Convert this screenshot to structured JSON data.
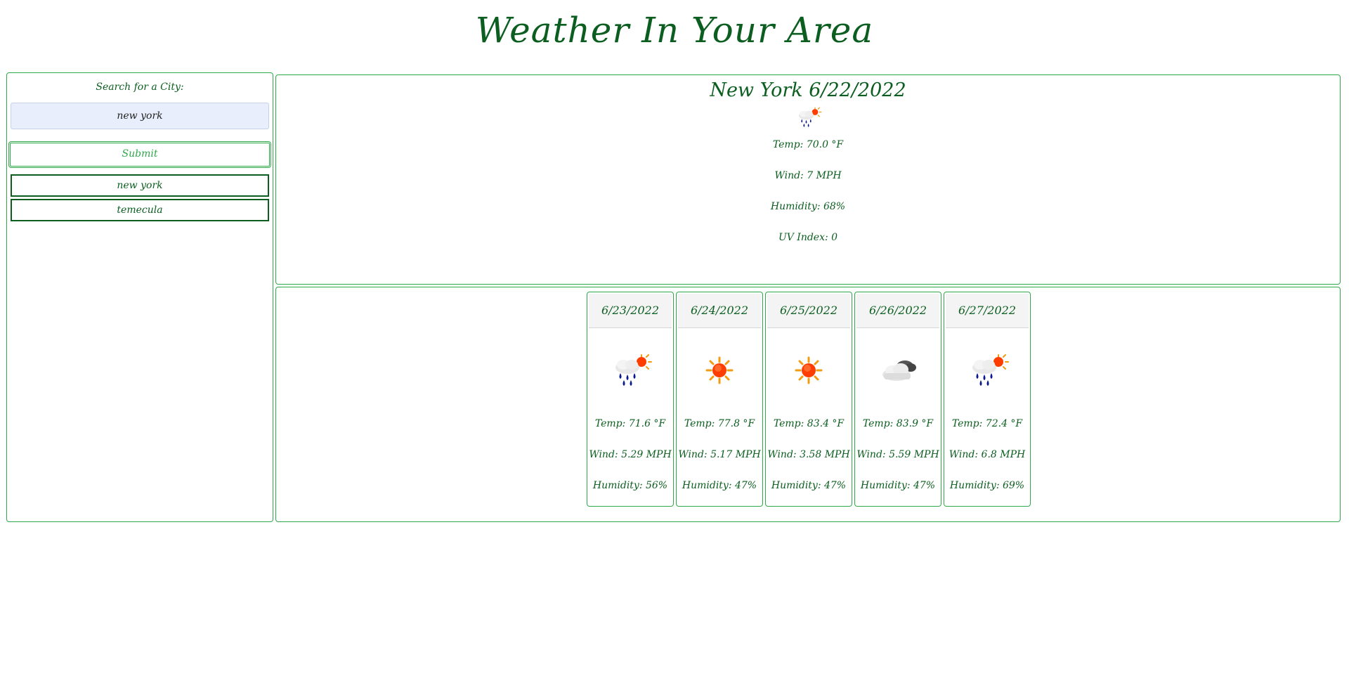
{
  "header": {
    "title": "Weather In Your Area"
  },
  "sidebar": {
    "search_label": "Search for a City:",
    "search_value": "new york",
    "submit_label": "Submit",
    "history": [
      "new york",
      "temecula"
    ]
  },
  "current": {
    "title": "New York 6/22/2022",
    "icon": "rain-sun-icon",
    "temp": "Temp: 70.0 °F",
    "wind": "Wind: 7 MPH",
    "humidity": "Humidity: 68%",
    "uv": "UV Index: 0"
  },
  "forecast": [
    {
      "date": "6/23/2022",
      "icon": "rain-sun-icon",
      "temp": "Temp: 71.6 °F",
      "wind": "Wind: 5.29 MPH",
      "humidity": "Humidity: 56%"
    },
    {
      "date": "6/24/2022",
      "icon": "sun-icon",
      "temp": "Temp: 77.8 °F",
      "wind": "Wind: 5.17 MPH",
      "humidity": "Humidity: 47%"
    },
    {
      "date": "6/25/2022",
      "icon": "sun-icon",
      "temp": "Temp: 83.4 °F",
      "wind": "Wind: 3.58 MPH",
      "humidity": "Humidity: 47%"
    },
    {
      "date": "6/26/2022",
      "icon": "cloud-icon",
      "temp": "Temp: 83.9 °F",
      "wind": "Wind: 5.59 MPH",
      "humidity": "Humidity: 47%"
    },
    {
      "date": "6/27/2022",
      "icon": "rain-sun-icon",
      "temp": "Temp: 72.4 °F",
      "wind": "Wind: 6.8 MPH",
      "humidity": "Humidity: 69%"
    }
  ],
  "colors": {
    "accent": "#0b5e1f",
    "border": "#2fa84a",
    "input_bg": "#e8eefb"
  }
}
